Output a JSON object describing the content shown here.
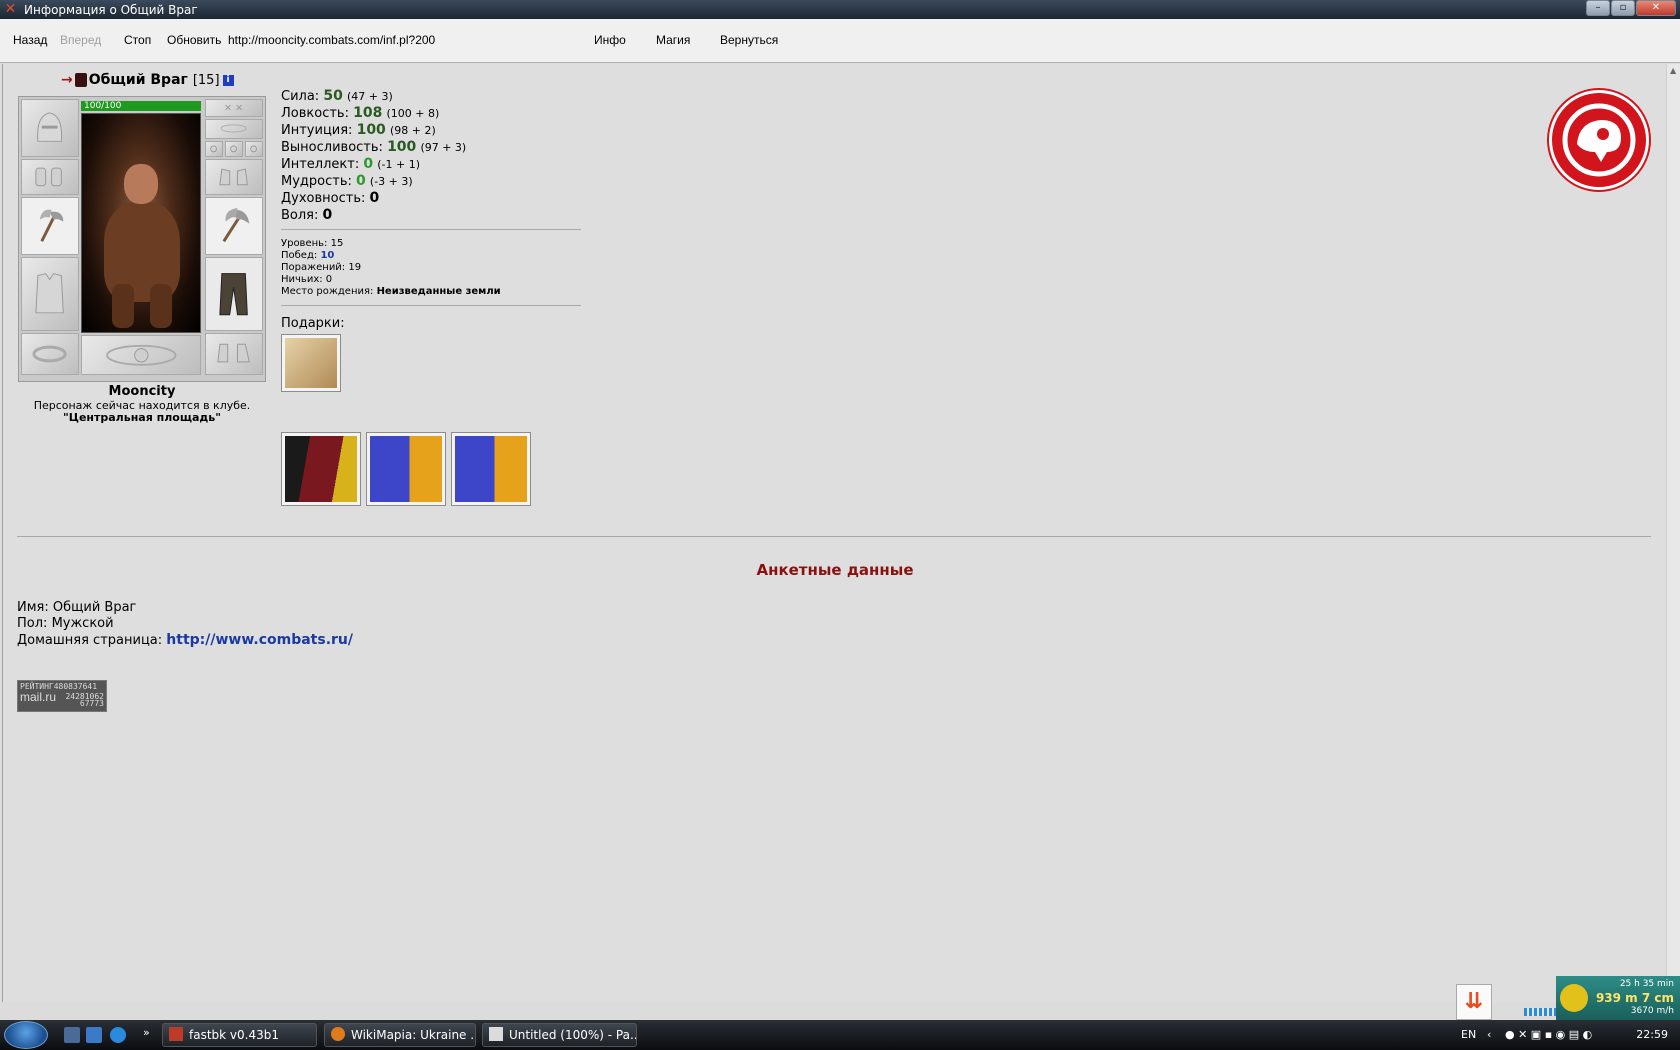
{
  "window": {
    "title": "Информация о Общий Враг"
  },
  "toolbar": {
    "back": "Назад",
    "forward": "Вперед",
    "stop": "Стоп",
    "refresh": "Обновить",
    "url": "http://mooncity.combats.com/inf.pl?200",
    "info": "Инфо",
    "magic": "Магия",
    "return": "Вернуться"
  },
  "character": {
    "name": "Общий Враг",
    "level": "[15]",
    "hp": "100/100",
    "hp_fraction": 1.0,
    "city": "Mooncity",
    "location_line": "Персонаж сейчас находится в клубе.",
    "location_name": "\"Центральная площадь\""
  },
  "stats": [
    {
      "label": "Сила:",
      "value": "50",
      "mod": "(47 + 3)"
    },
    {
      "label": "Ловкость:",
      "value": "108",
      "mod": "(100 + 8)"
    },
    {
      "label": "Интуиция:",
      "value": "100",
      "mod": "(98 + 2)"
    },
    {
      "label": "Выносливость:",
      "value": "100",
      "mod": "(97 + 3)"
    },
    {
      "label": "Интеллект:",
      "value": "0",
      "mod": "(-1 + 1)"
    },
    {
      "label": "Мудрость:",
      "value": "0",
      "mod": "(-3 + 3)"
    },
    {
      "label": "Духовность:",
      "value": "0",
      "mod": ""
    },
    {
      "label": "Воля:",
      "value": "0",
      "mod": ""
    }
  ],
  "record": {
    "level_label": "Уровень:",
    "level": "15",
    "wins_label": "Побед:",
    "wins": "10",
    "losses_label": "Поражений:",
    "losses": "19",
    "draws_label": "Ничьих:",
    "draws": "0",
    "birth_label": "Место рождения:",
    "birth": "Неизведанные земли"
  },
  "gifts": {
    "label": "Подарки:"
  },
  "profile": {
    "title": "Анкетные данные",
    "name_label": "Имя:",
    "name": "Общий Враг",
    "gender_label": "Пол:",
    "gender": "Мужской",
    "homepage_label": "Домашняя страница:",
    "homepage": "http://www.combats.ru/"
  },
  "counter": {
    "line1": "РЕЙТИНГ480837641",
    "line2": "mail.ru",
    "line3": "24281062",
    "line4": "67773"
  },
  "taskbar": {
    "tasks": [
      "fastbk v0.43b1",
      "WikiMapia: Ukraine ...",
      "Untitled (100%) - Pa..."
    ],
    "lang": "EN",
    "clock": "22:59"
  },
  "net_widget": {
    "line1": "25 h 35 min",
    "line2": "939 m 7 cm",
    "line3": "3670 m/h"
  },
  "colors": {
    "title_red": "#8b1010",
    "link_blue": "#1b3aa0",
    "stat_green": "#2a5a22",
    "clan_red": "#d2141c"
  }
}
